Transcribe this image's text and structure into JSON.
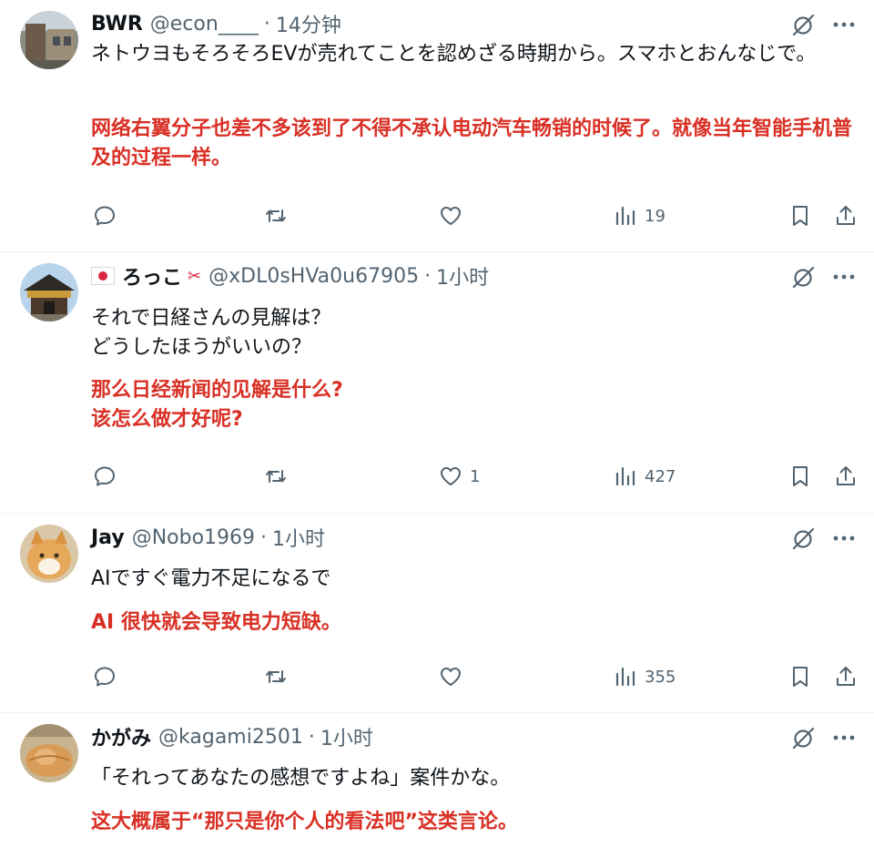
{
  "tweets": [
    {
      "name": "BWR",
      "handle": "@econ____",
      "dot": "·",
      "time": "14分钟",
      "text": "ネトウヨもそろそろEVが売れてことを認めざる時期から。スマホとおんなじで。",
      "translation": "网络右翼分子也差不多该到了不得不承认电动汽车畅销的时候了。就像当年智能手机普及的过程一样。",
      "likes": "",
      "views": "19"
    },
    {
      "name": "ろっこ",
      "name_emoji": "✂",
      "handle": "@xDL0sHVa0u67905",
      "dot": "·",
      "time": "1小时",
      "text": "それで日経さんの見解は？\nどうしたほうがいいの？",
      "translation": "那么日经新闻的见解是什么?\n该怎么做才好呢?",
      "likes": "1",
      "views": "427"
    },
    {
      "name": "Jay",
      "handle": "@Nobo1969",
      "dot": "·",
      "time": "1小时",
      "text": "AIですぐ電力不足になるで",
      "translation": "AI 很快就会导致电力短缺。",
      "likes": "",
      "views": "355"
    },
    {
      "name": "かがみ",
      "handle": "@kagami2501",
      "dot": "·",
      "time": "1小时",
      "text": "「それってあなたの感想ですよね」案件かな。",
      "translation": "这大概属于“那只是你个人的看法吧”这类言论。"
    }
  ],
  "icons": {
    "grok": "grok-icon",
    "more": "more-icon",
    "reply": "reply-icon",
    "retweet": "retweet-icon",
    "like": "like-icon",
    "views": "views-icon",
    "bookmark": "bookmark-icon",
    "share": "share-icon"
  },
  "colors": {
    "translation": "#d93025",
    "secondary_text": "#536471",
    "divider": "#eff3f4"
  }
}
